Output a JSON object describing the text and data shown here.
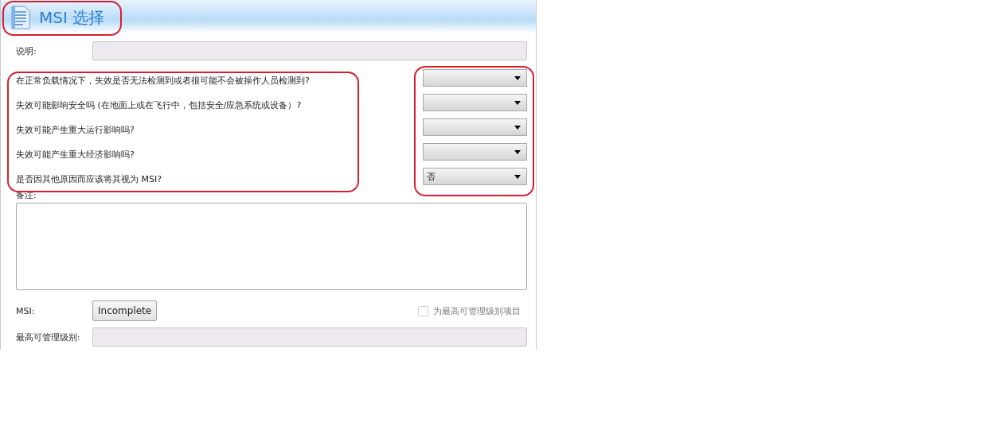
{
  "title": "MSI 选择",
  "description": {
    "label": "说明:"
  },
  "questions": [
    {
      "label": "在正常负载情况下，失效是否无法检测到或者很可能不会被操作人员检测到?"
    },
    {
      "label": "失效可能影响安全吗 (在地面上或在飞行中，包括安全/应急系统或设备）?"
    },
    {
      "label": "失效可能产生重大运行影响吗?"
    },
    {
      "label": "失效可能产生重大经济影响吗?"
    },
    {
      "label": "是否因其他原因而应该将其视为 MSI?",
      "value": "否"
    }
  ],
  "notes": {
    "label": "备注:"
  },
  "msi": {
    "label": "MSI:",
    "button": "Incomplete"
  },
  "top_level_item": {
    "label": "为最高可管理级别项目",
    "checked": false
  },
  "top_level": {
    "label": "最高可管理级别:"
  }
}
